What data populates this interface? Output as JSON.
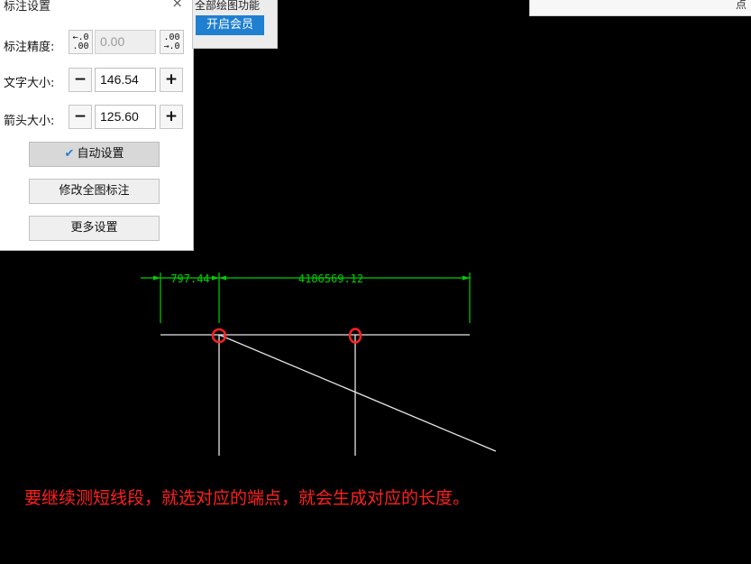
{
  "panel": {
    "title": "标注设置",
    "close_glyph": "×",
    "precision": {
      "label": "标注精度:",
      "decrease_top": "←.0",
      "decrease_bottom": ".00",
      "value": "0.00",
      "increase_top": ".00",
      "increase_bottom": "→.0"
    },
    "text_size": {
      "label": "文字大小:",
      "minus": "−",
      "value": "146.54",
      "plus": "+"
    },
    "arrow_size": {
      "label": "箭头大小:",
      "minus": "−",
      "value": "125.60",
      "plus": "+"
    },
    "auto_setting": {
      "check_glyph": "✔",
      "label": "自动设置",
      "checked": true
    },
    "modify_all_label": "修改全图标注",
    "more_settings_label": "更多设置"
  },
  "member_popup": {
    "text": "全部绘图功能",
    "button_label": "开启会员"
  },
  "right_popup": {
    "text": "点"
  },
  "drawing": {
    "dimension_left": "797.44",
    "dimension_right": "4186569.12",
    "dimension_color": "#00d000",
    "line_color": "#e6e6e6",
    "marker_color": "#ff2020"
  },
  "caption": "要继续测短线段，就选对应的端点，就会生成对应的长度。"
}
